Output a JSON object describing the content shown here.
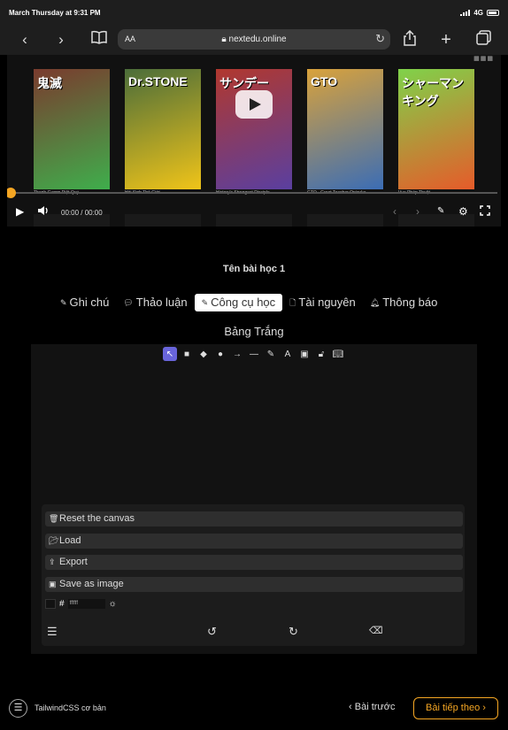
{
  "status_bar": {
    "time": "March Thursday at 9:31 PM",
    "network": "4G"
  },
  "browser": {
    "aa": "AA",
    "host": "nextedu.online"
  },
  "video": {
    "covers": [
      {
        "title": "鬼滅",
        "caption": "Thanh Gươm Diệt Quỷ",
        "bg": "#7a3b2e",
        "accent": "#3fae4c"
      },
      {
        "title": "Dr.STONE",
        "caption": "Hồi Sinh Thế Giới",
        "bg": "#4b6d3a",
        "accent": "#f0c419"
      },
      {
        "title": "サンデー",
        "caption": "History's Strongest Disciple ...",
        "bg": "#b1382e",
        "accent": "#5a3fa0"
      },
      {
        "title": "GTO",
        "caption": "GTO - Great Teacher Onizuka",
        "bg": "#d9a23b",
        "accent": "#3b6db5"
      },
      {
        "title": "シャーマンキング",
        "caption": "Vua Pháp Thuật",
        "bg": "#7fd24a",
        "accent": "#e65b2a"
      }
    ],
    "current_time": "00:00 / 00:00",
    "progress_percent": 0
  },
  "lesson": {
    "title": "Tên bài học 1"
  },
  "tabs": [
    {
      "label": "Ghi chú",
      "icon": "pencil-icon",
      "active": false
    },
    {
      "label": "Thảo luận",
      "icon": "chat-icon",
      "active": false
    },
    {
      "label": "Công cụ học",
      "icon": "tool-icon",
      "active": true
    },
    {
      "label": "Tài nguyên",
      "icon": "file-icon",
      "active": false
    },
    {
      "label": "Thông báo",
      "icon": "bell-icon",
      "active": false
    }
  ],
  "whiteboard": {
    "title": "Bảng Trắng",
    "tools": [
      "select",
      "rectangle",
      "diamond",
      "ellipse",
      "arrow",
      "line",
      "draw",
      "text",
      "image",
      "lock",
      "library"
    ],
    "menu": {
      "reset": "Reset the canvas",
      "load": "Load",
      "export": "Export",
      "save_image": "Save as image",
      "hex_symbol": "#",
      "hex_value": "ffffff"
    },
    "accent": "#6965db"
  },
  "footer": {
    "course_title": "TailwindCSS cơ bản",
    "prev_label": "Bài trước",
    "next_label": "Bài tiếp theo",
    "accent": "#f5a623"
  }
}
